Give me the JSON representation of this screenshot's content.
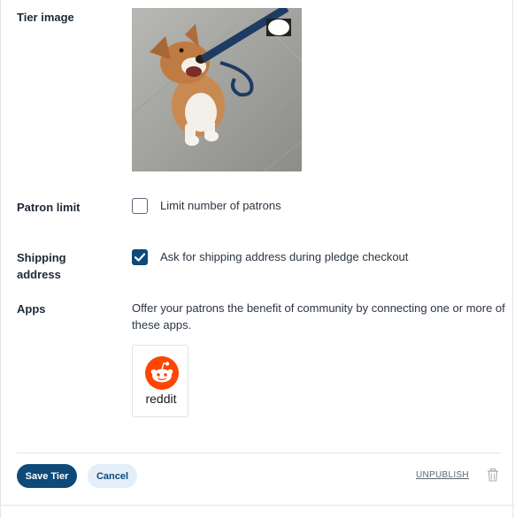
{
  "tier_image": {
    "label": "Tier image"
  },
  "patron_limit": {
    "label": "Patron limit",
    "option_label": "Limit number of patrons",
    "checked": false
  },
  "shipping_address": {
    "label_line1": "Shipping",
    "label_line2": "address",
    "option_label": "Ask for shipping address during pledge checkout",
    "checked": true
  },
  "apps": {
    "label": "Apps",
    "description": "Offer your patrons the benefit of community by connecting one or more of these apps.",
    "items": [
      {
        "name": "reddit",
        "icon": "reddit-icon",
        "color": "#ff4500"
      }
    ]
  },
  "actions": {
    "save_label": "Save Tier",
    "cancel_label": "Cancel",
    "unpublish_label": "UNPUBLISH",
    "delete_icon": "trash-icon"
  },
  "colors": {
    "primary": "#0d4a7a",
    "secondary_bg": "#e3eef8",
    "reddit": "#ff4500"
  }
}
